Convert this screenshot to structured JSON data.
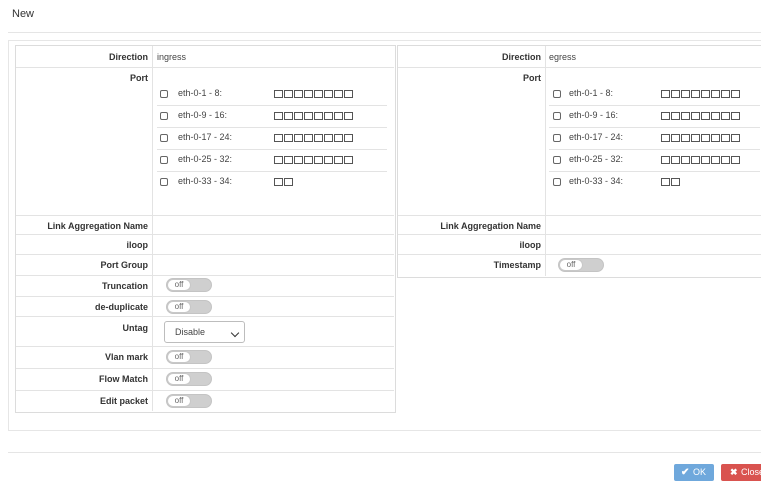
{
  "dialog": {
    "title": "New"
  },
  "left": {
    "direction_label": "Direction",
    "direction_value": "ingress",
    "port_label": "Port",
    "ports": [
      {
        "name": "eth-0-1 - 8:",
        "count": 8
      },
      {
        "name": "eth-0-9 - 16:",
        "count": 8
      },
      {
        "name": "eth-0-17 - 24:",
        "count": 8
      },
      {
        "name": "eth-0-25 - 32:",
        "count": 8
      },
      {
        "name": "eth-0-33 - 34:",
        "count": 2
      }
    ],
    "link_agg_label": "Link Aggregation Name",
    "iloop_label": "iloop",
    "port_group_label": "Port Group",
    "truncation_label": "Truncation",
    "truncation_state": "off",
    "dedup_label": "de-duplicate",
    "dedup_state": "off",
    "untag_label": "Untag",
    "untag_value": "Disable",
    "vlan_mark_label": "Vlan mark",
    "vlan_mark_state": "off",
    "flow_match_label": "Flow Match",
    "flow_match_state": "off",
    "edit_packet_label": "Edit packet",
    "edit_packet_state": "off"
  },
  "right": {
    "direction_label": "Direction",
    "direction_value": "egress",
    "port_label": "Port",
    "ports": [
      {
        "name": "eth-0-1 - 8:",
        "count": 8
      },
      {
        "name": "eth-0-9 - 16:",
        "count": 8
      },
      {
        "name": "eth-0-17 - 24:",
        "count": 8
      },
      {
        "name": "eth-0-25 - 32:",
        "count": 8
      },
      {
        "name": "eth-0-33 - 34:",
        "count": 2
      }
    ],
    "link_agg_label": "Link Aggregation Name",
    "iloop_label": "iloop",
    "timestamp_label": "Timestamp",
    "timestamp_state": "off"
  },
  "footer": {
    "ok_label": "OK",
    "close_label": "Close",
    "ok_icon": "check-icon",
    "close_icon": "x-icon"
  }
}
